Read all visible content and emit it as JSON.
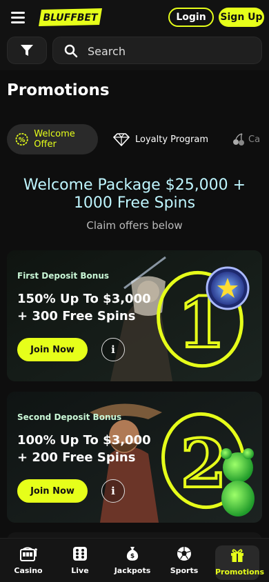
{
  "header": {
    "logo_text": "BLUFFBET",
    "login_label": "Login",
    "signup_label": "Sign Up"
  },
  "search": {
    "placeholder": "Search"
  },
  "page": {
    "title": "Promotions"
  },
  "tabs": [
    {
      "label": "Welcome Offer",
      "icon": "percent-badge-icon",
      "active": true
    },
    {
      "label": "Loyalty Program",
      "icon": "diamond-icon",
      "active": false
    },
    {
      "label": "Ca",
      "icon": "cherries-icon",
      "active": false
    }
  ],
  "welcome": {
    "heading_line1": "Welcome Package $25,000 +",
    "heading_line2": "1000 Free Spins",
    "subheading": "Claim offers below"
  },
  "promos": [
    {
      "label": "First Deposit Bonus",
      "headline_line1": "150% Up To $3,000",
      "headline_line2": "+ 300 Free Spins",
      "cta": "Join Now",
      "info": "i",
      "number": "1"
    },
    {
      "label": "Second Deposit Bonus",
      "headline_line1": "100% Up To $3,000",
      "headline_line2": "+ 200 Free Spins",
      "cta": "Join Now",
      "info": "i",
      "number": "2"
    }
  ],
  "bottom_nav": [
    {
      "label": "Casino",
      "icon": "slot-machine-icon"
    },
    {
      "label": "Live",
      "icon": "dice-icon"
    },
    {
      "label": "Jackpots",
      "icon": "money-bag-icon"
    },
    {
      "label": "Sports",
      "icon": "soccer-ball-icon"
    },
    {
      "label": "Promotions",
      "icon": "gift-icon",
      "active": true
    }
  ],
  "colors": {
    "accent": "#e6ff1a",
    "background": "#0e0e0e",
    "welcome_text": "#bff6ff"
  }
}
